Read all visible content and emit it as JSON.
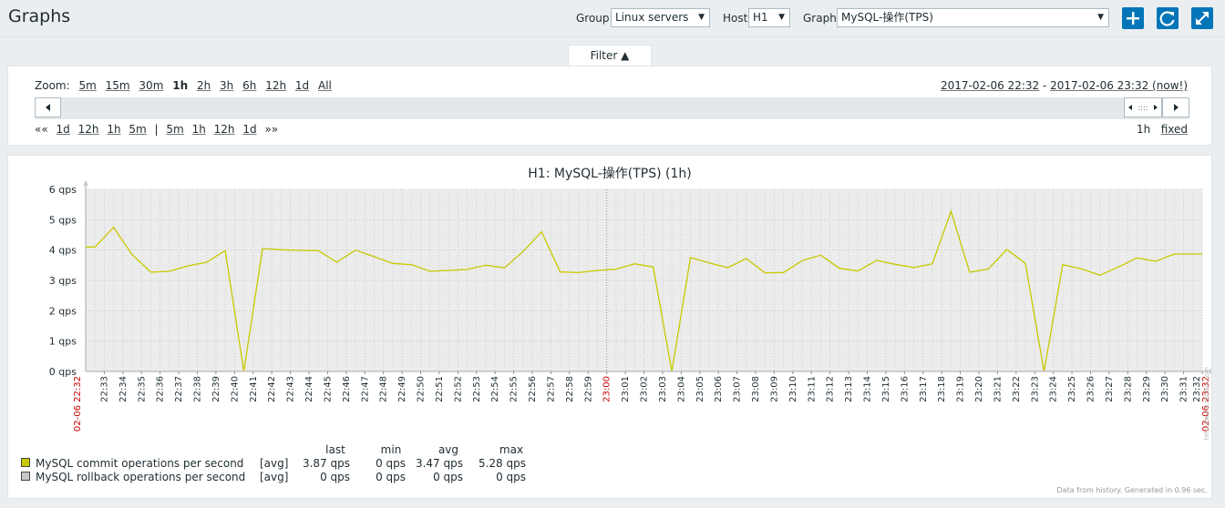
{
  "header": {
    "title": "Graphs",
    "group_label": "Group",
    "group_value": "Linux servers",
    "host_label": "Host",
    "host_value": "H1",
    "graph_label": "Graph",
    "graph_value": "MySQL-操作(TPS)",
    "buttons": [
      "plus-icon",
      "refresh-icon",
      "fullscreen-icon"
    ],
    "accent": "#0275b8"
  },
  "filter": {
    "tab_label": "Filter ▲",
    "zoom_label": "Zoom:",
    "zoom_options": [
      "5m",
      "15m",
      "30m",
      "1h",
      "2h",
      "3h",
      "6h",
      "12h",
      "1d",
      "All"
    ],
    "zoom_selected": "1h",
    "date_from": "2017-02-06 22:32",
    "date_sep": " - ",
    "date_to": "2017-02-06 23:32 (now!)",
    "nav_back_all": "««",
    "nav_back": [
      "1d",
      "12h",
      "1h",
      "5m"
    ],
    "nav_sep": "|",
    "nav_fwd": [
      "5m",
      "1h",
      "12h",
      "1d"
    ],
    "nav_fwd_all": "»»",
    "period": "1h",
    "fixed_label": "fixed"
  },
  "graph": {
    "footnote": "Data from history. Generated in 0.96 sec.",
    "watermark": "http://www.zabbix.com",
    "legend_headers": [
      "last",
      "min",
      "avg",
      "max"
    ],
    "legend": [
      {
        "name": "MySQL commit operations per second",
        "func": "[avg]",
        "last": "3.87 qps",
        "min": "0 qps",
        "avg": "3.47 qps",
        "max": "5.28 qps",
        "color": "#c8c800"
      },
      {
        "name": "MySQL rollback operations per second",
        "func": "[avg]",
        "last": "0 qps",
        "min": "0 qps",
        "avg": "0 qps",
        "max": "0 qps",
        "color": "#c8c8c8"
      }
    ]
  },
  "chart_data": {
    "type": "line",
    "title": "H1: MySQL-操作(TPS) (1h)",
    "y_ticks": [
      "0 qps",
      "1 qps",
      "2 qps",
      "3 qps",
      "4 qps",
      "5 qps",
      "6 qps"
    ],
    "ylim": [
      0,
      6
    ],
    "x_start_label": "02-06 22:32",
    "x_end_label": "02-06 23:32",
    "x_ticks": [
      "22:33",
      "22:34",
      "22:35",
      "22:36",
      "22:37",
      "22:38",
      "22:39",
      "22:40",
      "22:41",
      "22:42",
      "22:43",
      "22:44",
      "22:45",
      "22:46",
      "22:47",
      "22:48",
      "22:49",
      "22:50",
      "22:51",
      "22:52",
      "22:53",
      "22:54",
      "22:55",
      "22:56",
      "22:57",
      "22:58",
      "22:59",
      "23:00",
      "23:01",
      "23:02",
      "23:03",
      "23:04",
      "23:05",
      "23:06",
      "23:07",
      "23:08",
      "23:09",
      "23:10",
      "23:11",
      "23:12",
      "23:13",
      "23:14",
      "23:15",
      "23:16",
      "23:17",
      "23:18",
      "23:19",
      "23:20",
      "23:21",
      "23:22",
      "23:23",
      "23:24",
      "23:25",
      "23:26",
      "23:27",
      "23:28",
      "23:29",
      "23:30",
      "23:31",
      "23:32"
    ],
    "x_highlight": "23:00",
    "grid": true,
    "series": [
      {
        "name": "MySQL commit operations per second",
        "color": "#c8c800",
        "x": [
          "22:32",
          "22:32:30",
          "22:33:30",
          "22:34:30",
          "22:35:30",
          "22:36:30",
          "22:37:30",
          "22:38:30",
          "22:39:30",
          "22:40:30",
          "22:41:30",
          "22:42:30",
          "22:43:30",
          "22:44:30",
          "22:45:30",
          "22:46:30",
          "22:47:30",
          "22:48:30",
          "22:49:30",
          "22:50:30",
          "22:51:30",
          "22:52:30",
          "22:53:30",
          "22:54:30",
          "22:55:30",
          "22:56:30",
          "22:57:30",
          "22:58:30",
          "22:59:30",
          "23:00:30",
          "23:01:30",
          "23:02:30",
          "23:03:30",
          "23:04:30",
          "23:05:30",
          "23:06:30",
          "23:07:30",
          "23:08:30",
          "23:09:30",
          "23:10:30",
          "23:11:30",
          "23:12:30",
          "23:13:30",
          "23:14:30",
          "23:15:30",
          "23:16:30",
          "23:17:30",
          "23:18:30",
          "23:19:30",
          "23:20:30",
          "23:21:30",
          "23:22:30",
          "23:23:30",
          "23:24:30",
          "23:25:30",
          "23:26:30",
          "23:27:30",
          "23:28:30",
          "23:29:30",
          "23:30:30",
          "23:31:30",
          "23:32"
        ],
        "values": [
          4.1,
          4.1,
          4.75,
          3.85,
          3.27,
          3.3,
          3.48,
          3.6,
          3.98,
          0,
          4.05,
          4.01,
          3.99,
          3.98,
          3.6,
          4.0,
          3.78,
          3.56,
          3.52,
          3.3,
          3.33,
          3.36,
          3.5,
          3.41,
          3.95,
          4.6,
          3.28,
          3.26,
          3.33,
          3.37,
          3.55,
          3.44,
          0,
          3.75,
          3.58,
          3.42,
          3.72,
          3.25,
          3.26,
          3.65,
          3.83,
          3.4,
          3.31,
          3.66,
          3.53,
          3.42,
          3.55,
          5.28,
          3.27,
          3.37,
          4.02,
          3.56,
          0,
          3.52,
          3.38,
          3.17,
          3.44,
          3.74,
          3.63,
          3.87,
          3.87,
          3.87
        ]
      },
      {
        "name": "MySQL rollback operations per second",
        "color": "#c8c8c8",
        "values": [
          0
        ]
      }
    ]
  }
}
